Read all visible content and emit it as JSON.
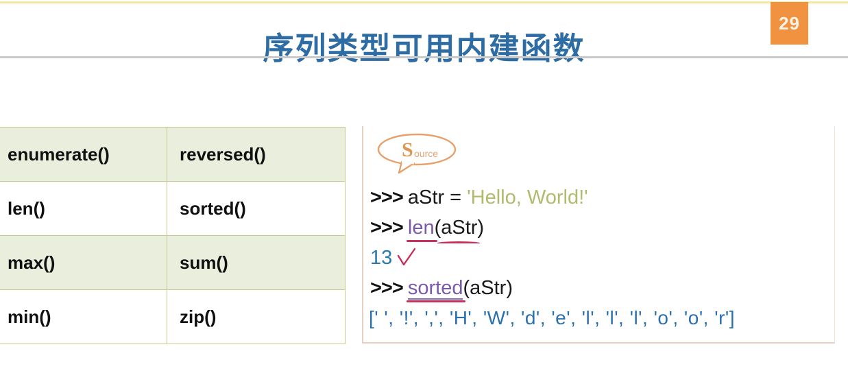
{
  "slide": {
    "title": "序列类型可用内建函数",
    "page_number": "29",
    "accent_color": "#f0923f",
    "title_color": "#2e6ca4",
    "top_line_color": "#f5e79e",
    "rule_color": "#c9c9c9"
  },
  "functions_table": {
    "rows": [
      {
        "left": "enumerate()",
        "right": "reversed()",
        "shaded": true
      },
      {
        "left": "len()",
        "right": "sorted()",
        "shaded": false
      },
      {
        "left": "max()",
        "right": "sum()",
        "shaded": true
      },
      {
        "left": "min()",
        "right": "zip()",
        "shaded": false
      }
    ],
    "shaded_color": "#eaeedd",
    "border_color": "#c4cc8e"
  },
  "code_panel": {
    "badge": {
      "letter": "S",
      "rest": "ource",
      "color": "#e8a06a"
    },
    "lines": [
      {
        "prompt": ">>> ",
        "code": "aStr = ",
        "string": "'Hello, World!'"
      },
      {
        "prompt": ">>> ",
        "fn": "len",
        "args": "(aStr)"
      },
      {
        "result": "13",
        "check": "✓"
      },
      {
        "prompt": ">>> ",
        "fn": "sorted",
        "args": "(aStr)"
      },
      {
        "result_list": "[' ', '!', ',', 'H', 'W', 'd', 'e', 'l', 'l', 'l', 'o', 'o', 'r']"
      }
    ],
    "colors": {
      "string": "#b0bb6e",
      "number": "#2a79ad",
      "list": "#2a6fae",
      "function": "#7a5aa8",
      "annotation": "#c8305c"
    }
  }
}
